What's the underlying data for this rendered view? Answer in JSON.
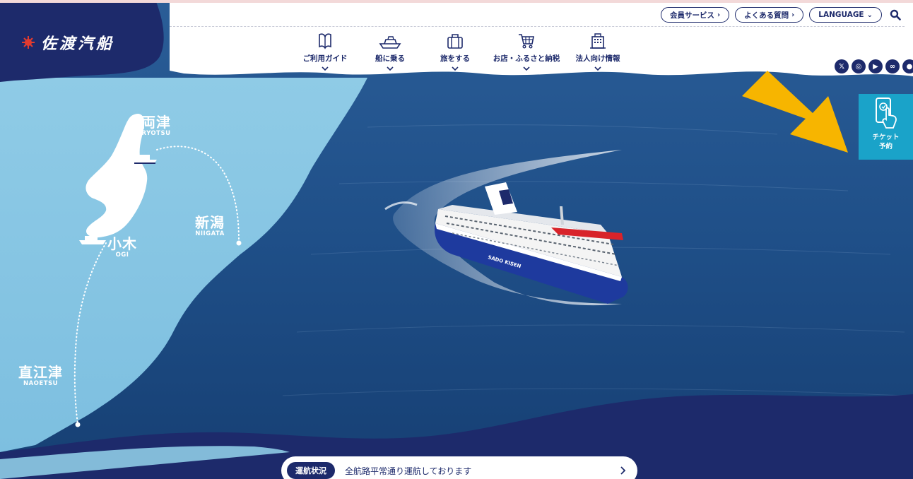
{
  "brand": {
    "name": "佐渡汽船"
  },
  "utility": {
    "member_label": "会員サービス",
    "faq_label": "よくある質問",
    "language_label": "LANGUAGE",
    "search_icon": "search-icon"
  },
  "nav": {
    "items": [
      {
        "label": "ご利用ガイド",
        "icon": "guide-book-icon"
      },
      {
        "label": "船に乗る",
        "icon": "ship-icon"
      },
      {
        "label": "旅をする",
        "icon": "suitcase-icon"
      },
      {
        "label": "お店・ふるさと納税",
        "icon": "cart-icon"
      },
      {
        "label": "法人向け情報",
        "icon": "building-icon"
      }
    ]
  },
  "social": {
    "items": [
      {
        "name": "x-icon",
        "glyph": "𝕏"
      },
      {
        "name": "instagram-icon",
        "glyph": "◎"
      },
      {
        "name": "youtube-icon",
        "glyph": "▶"
      },
      {
        "name": "tripadvisor-icon",
        "glyph": "∞"
      },
      {
        "name": "line-icon",
        "glyph": "●"
      }
    ]
  },
  "ticket": {
    "label_line1": "チケット",
    "label_line2": "予約"
  },
  "map": {
    "ryotsu": {
      "jp": "両津",
      "en": "RYOTSU"
    },
    "niigata": {
      "jp": "新潟",
      "en": "NIIGATA"
    },
    "ogi": {
      "jp": "小木",
      "en": "OGI"
    },
    "naoetsu": {
      "jp": "直江津",
      "en": "NAOETSU"
    }
  },
  "status": {
    "badge": "運航状況",
    "text": "全航路平常通り運航しております"
  },
  "colors": {
    "navy": "#1d2a6b",
    "sea_light": "#8fcbe6",
    "sea_deep": "#1d4f86",
    "ticket_blue": "#1aa3c9",
    "arrow_yellow": "#f7b500"
  }
}
